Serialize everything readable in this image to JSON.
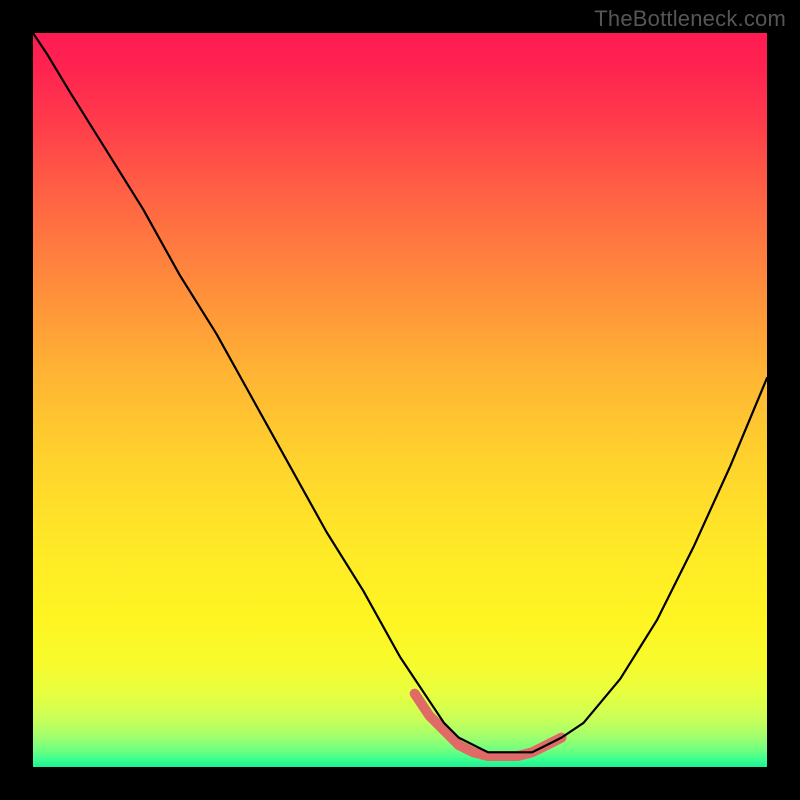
{
  "watermark": "TheBottleneck.com",
  "chart_data": {
    "type": "line",
    "title": "",
    "xlabel": "",
    "ylabel": "",
    "xlim": [
      0,
      100
    ],
    "ylim": [
      0,
      100
    ],
    "grid": false,
    "legend": false,
    "background": {
      "kind": "vertical-gradient",
      "description": "Smooth rainbow; red at top through orange/yellow, very thin bright-green strip at bottom",
      "stops": [
        {
          "pos": 0.0,
          "color": "#ff1b52"
        },
        {
          "pos": 0.05,
          "color": "#ff2450"
        },
        {
          "pos": 0.12,
          "color": "#ff3b4b"
        },
        {
          "pos": 0.22,
          "color": "#ff6244"
        },
        {
          "pos": 0.34,
          "color": "#ff8b3c"
        },
        {
          "pos": 0.46,
          "color": "#ffb334"
        },
        {
          "pos": 0.58,
          "color": "#ffd22d"
        },
        {
          "pos": 0.7,
          "color": "#ffe927"
        },
        {
          "pos": 0.8,
          "color": "#fef522"
        },
        {
          "pos": 0.86,
          "color": "#f7fb2d"
        },
        {
          "pos": 0.9,
          "color": "#e7ff40"
        },
        {
          "pos": 0.935,
          "color": "#c9ff58"
        },
        {
          "pos": 0.96,
          "color": "#9eff6e"
        },
        {
          "pos": 0.978,
          "color": "#6cff81"
        },
        {
          "pos": 0.99,
          "color": "#3bff90"
        },
        {
          "pos": 1.0,
          "color": "#1cf294"
        }
      ]
    },
    "series": [
      {
        "name": "bottleneck-curve",
        "color": "#000000",
        "width": 2.2,
        "x": [
          0,
          2,
          5,
          10,
          15,
          20,
          25,
          30,
          35,
          40,
          45,
          50,
          52,
          54,
          56,
          58,
          60,
          62,
          64,
          66,
          68,
          70,
          72,
          75,
          80,
          85,
          90,
          95,
          100
        ],
        "values": [
          100,
          97,
          92,
          84,
          76,
          67,
          59,
          50,
          41,
          32,
          24,
          15,
          12,
          9,
          6,
          4,
          3,
          2,
          2,
          2,
          2,
          3,
          4,
          6,
          12,
          20,
          30,
          41,
          53
        ]
      }
    ],
    "annotations": [
      {
        "name": "valley-highlight",
        "kind": "thick-stroke",
        "color": "#e06a66",
        "width": 10,
        "x": [
          52,
          54,
          56,
          58,
          60,
          62,
          64,
          66,
          68,
          70,
          72
        ],
        "values": [
          10,
          7,
          5,
          3,
          2,
          1.5,
          1.5,
          1.5,
          2,
          3,
          4
        ]
      }
    ]
  }
}
